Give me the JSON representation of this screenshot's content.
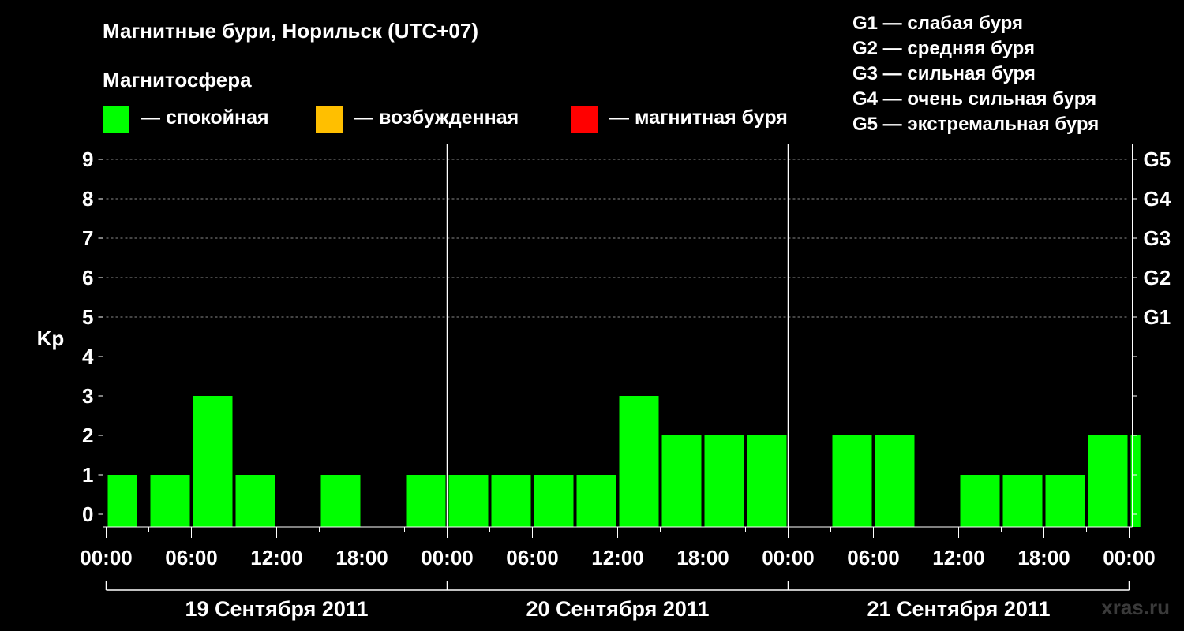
{
  "header": {
    "title": "Магнитные бури, Норильск (UTC+07)",
    "subtitle": "Магнитосфера"
  },
  "legend": {
    "items": [
      {
        "color": "#00ff00",
        "label": "— спокойная"
      },
      {
        "color": "#ffbf00",
        "label": "— возбужденная"
      },
      {
        "color": "#ff0000",
        "label": "— магнитная буря"
      }
    ]
  },
  "g_scale": {
    "lines": [
      "G1 — слабая буря",
      "G2 — средняя буря",
      "G3 — сильная буря",
      "G4 — очень сильная буря",
      "G5 — экстремальная буря"
    ]
  },
  "watermark": "xras.ru",
  "chart_data": {
    "type": "bar",
    "ylabel": "Kp",
    "ylim": [
      0,
      9
    ],
    "y_ticks": [
      0,
      1,
      2,
      3,
      4,
      5,
      6,
      7,
      8,
      9
    ],
    "right_ticks": [
      {
        "value": 5,
        "label": "G1"
      },
      {
        "value": 6,
        "label": "G2"
      },
      {
        "value": 7,
        "label": "G3"
      },
      {
        "value": 8,
        "label": "G4"
      },
      {
        "value": 9,
        "label": "G5"
      }
    ],
    "x_tick_labels": [
      "00:00",
      "06:00",
      "12:00",
      "18:00",
      "00:00",
      "06:00",
      "12:00",
      "18:00",
      "00:00",
      "06:00",
      "12:00",
      "18:00",
      "00:00"
    ],
    "days": [
      "19 Сентября 2011",
      "20 Сентября 2011",
      "21 Сентября 2011"
    ],
    "grid": true,
    "bar_color": "#00ff00",
    "bars": [
      {
        "start_hour": 0,
        "end_hour": 2.25,
        "kp": 1
      },
      {
        "start_hour": 3,
        "end_hour": 6,
        "kp": 1
      },
      {
        "start_hour": 6,
        "end_hour": 9,
        "kp": 3
      },
      {
        "start_hour": 9,
        "end_hour": 12,
        "kp": 1
      },
      {
        "start_hour": 12,
        "end_hour": 15,
        "kp": 0
      },
      {
        "start_hour": 15,
        "end_hour": 18,
        "kp": 1
      },
      {
        "start_hour": 18,
        "end_hour": 21,
        "kp": 0
      },
      {
        "start_hour": 21,
        "end_hour": 24,
        "kp": 1
      },
      {
        "start_hour": 24,
        "end_hour": 27,
        "kp": 1
      },
      {
        "start_hour": 27,
        "end_hour": 30,
        "kp": 1
      },
      {
        "start_hour": 30,
        "end_hour": 33,
        "kp": 1
      },
      {
        "start_hour": 33,
        "end_hour": 36,
        "kp": 1
      },
      {
        "start_hour": 36,
        "end_hour": 39,
        "kp": 3
      },
      {
        "start_hour": 39,
        "end_hour": 42,
        "kp": 2
      },
      {
        "start_hour": 42,
        "end_hour": 45,
        "kp": 2
      },
      {
        "start_hour": 45,
        "end_hour": 48,
        "kp": 2
      },
      {
        "start_hour": 48,
        "end_hour": 51,
        "kp": 0
      },
      {
        "start_hour": 51,
        "end_hour": 54,
        "kp": 2
      },
      {
        "start_hour": 54,
        "end_hour": 57,
        "kp": 2
      },
      {
        "start_hour": 57,
        "end_hour": 60,
        "kp": 0
      },
      {
        "start_hour": 60,
        "end_hour": 63,
        "kp": 1
      },
      {
        "start_hour": 63,
        "end_hour": 66,
        "kp": 1
      },
      {
        "start_hour": 66,
        "end_hour": 69,
        "kp": 1
      },
      {
        "start_hour": 69,
        "end_hour": 72,
        "kp": 2
      },
      {
        "start_hour": 72,
        "end_hour": 72.9,
        "kp": 2
      }
    ]
  }
}
